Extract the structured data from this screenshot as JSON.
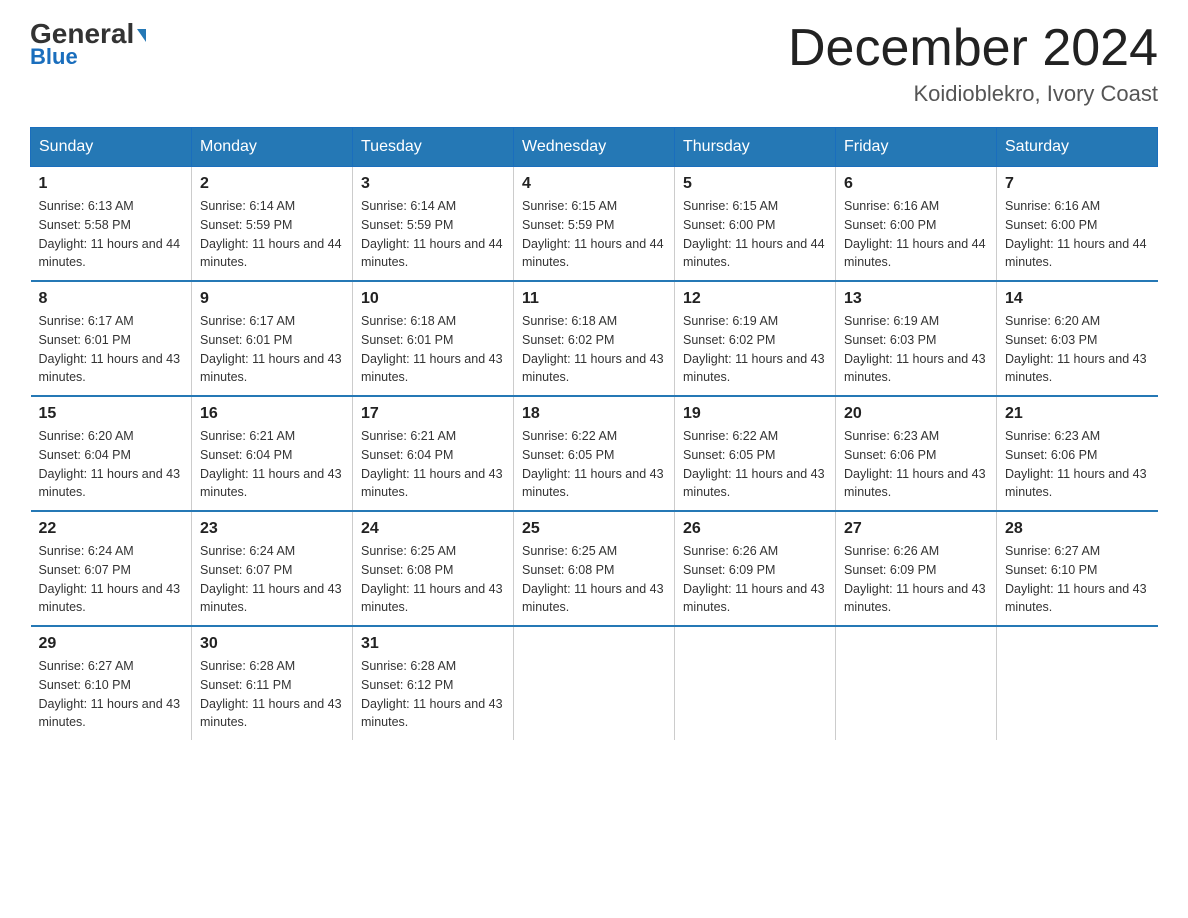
{
  "header": {
    "logo_line1": "General",
    "logo_line2": "Blue",
    "month_title": "December 2024",
    "location": "Koidioblekro, Ivory Coast"
  },
  "days_of_week": [
    "Sunday",
    "Monday",
    "Tuesday",
    "Wednesday",
    "Thursday",
    "Friday",
    "Saturday"
  ],
  "weeks": [
    [
      {
        "day": "1",
        "sunrise": "6:13 AM",
        "sunset": "5:58 PM",
        "daylight": "11 hours and 44 minutes."
      },
      {
        "day": "2",
        "sunrise": "6:14 AM",
        "sunset": "5:59 PM",
        "daylight": "11 hours and 44 minutes."
      },
      {
        "day": "3",
        "sunrise": "6:14 AM",
        "sunset": "5:59 PM",
        "daylight": "11 hours and 44 minutes."
      },
      {
        "day": "4",
        "sunrise": "6:15 AM",
        "sunset": "5:59 PM",
        "daylight": "11 hours and 44 minutes."
      },
      {
        "day": "5",
        "sunrise": "6:15 AM",
        "sunset": "6:00 PM",
        "daylight": "11 hours and 44 minutes."
      },
      {
        "day": "6",
        "sunrise": "6:16 AM",
        "sunset": "6:00 PM",
        "daylight": "11 hours and 44 minutes."
      },
      {
        "day": "7",
        "sunrise": "6:16 AM",
        "sunset": "6:00 PM",
        "daylight": "11 hours and 44 minutes."
      }
    ],
    [
      {
        "day": "8",
        "sunrise": "6:17 AM",
        "sunset": "6:01 PM",
        "daylight": "11 hours and 43 minutes."
      },
      {
        "day": "9",
        "sunrise": "6:17 AM",
        "sunset": "6:01 PM",
        "daylight": "11 hours and 43 minutes."
      },
      {
        "day": "10",
        "sunrise": "6:18 AM",
        "sunset": "6:01 PM",
        "daylight": "11 hours and 43 minutes."
      },
      {
        "day": "11",
        "sunrise": "6:18 AM",
        "sunset": "6:02 PM",
        "daylight": "11 hours and 43 minutes."
      },
      {
        "day": "12",
        "sunrise": "6:19 AM",
        "sunset": "6:02 PM",
        "daylight": "11 hours and 43 minutes."
      },
      {
        "day": "13",
        "sunrise": "6:19 AM",
        "sunset": "6:03 PM",
        "daylight": "11 hours and 43 minutes."
      },
      {
        "day": "14",
        "sunrise": "6:20 AM",
        "sunset": "6:03 PM",
        "daylight": "11 hours and 43 minutes."
      }
    ],
    [
      {
        "day": "15",
        "sunrise": "6:20 AM",
        "sunset": "6:04 PM",
        "daylight": "11 hours and 43 minutes."
      },
      {
        "day": "16",
        "sunrise": "6:21 AM",
        "sunset": "6:04 PM",
        "daylight": "11 hours and 43 minutes."
      },
      {
        "day": "17",
        "sunrise": "6:21 AM",
        "sunset": "6:04 PM",
        "daylight": "11 hours and 43 minutes."
      },
      {
        "day": "18",
        "sunrise": "6:22 AM",
        "sunset": "6:05 PM",
        "daylight": "11 hours and 43 minutes."
      },
      {
        "day": "19",
        "sunrise": "6:22 AM",
        "sunset": "6:05 PM",
        "daylight": "11 hours and 43 minutes."
      },
      {
        "day": "20",
        "sunrise": "6:23 AM",
        "sunset": "6:06 PM",
        "daylight": "11 hours and 43 minutes."
      },
      {
        "day": "21",
        "sunrise": "6:23 AM",
        "sunset": "6:06 PM",
        "daylight": "11 hours and 43 minutes."
      }
    ],
    [
      {
        "day": "22",
        "sunrise": "6:24 AM",
        "sunset": "6:07 PM",
        "daylight": "11 hours and 43 minutes."
      },
      {
        "day": "23",
        "sunrise": "6:24 AM",
        "sunset": "6:07 PM",
        "daylight": "11 hours and 43 minutes."
      },
      {
        "day": "24",
        "sunrise": "6:25 AM",
        "sunset": "6:08 PM",
        "daylight": "11 hours and 43 minutes."
      },
      {
        "day": "25",
        "sunrise": "6:25 AM",
        "sunset": "6:08 PM",
        "daylight": "11 hours and 43 minutes."
      },
      {
        "day": "26",
        "sunrise": "6:26 AM",
        "sunset": "6:09 PM",
        "daylight": "11 hours and 43 minutes."
      },
      {
        "day": "27",
        "sunrise": "6:26 AM",
        "sunset": "6:09 PM",
        "daylight": "11 hours and 43 minutes."
      },
      {
        "day": "28",
        "sunrise": "6:27 AM",
        "sunset": "6:10 PM",
        "daylight": "11 hours and 43 minutes."
      }
    ],
    [
      {
        "day": "29",
        "sunrise": "6:27 AM",
        "sunset": "6:10 PM",
        "daylight": "11 hours and 43 minutes."
      },
      {
        "day": "30",
        "sunrise": "6:28 AM",
        "sunset": "6:11 PM",
        "daylight": "11 hours and 43 minutes."
      },
      {
        "day": "31",
        "sunrise": "6:28 AM",
        "sunset": "6:12 PM",
        "daylight": "11 hours and 43 minutes."
      },
      {
        "day": "",
        "sunrise": "",
        "sunset": "",
        "daylight": ""
      },
      {
        "day": "",
        "sunrise": "",
        "sunset": "",
        "daylight": ""
      },
      {
        "day": "",
        "sunrise": "",
        "sunset": "",
        "daylight": ""
      },
      {
        "day": "",
        "sunrise": "",
        "sunset": "",
        "daylight": ""
      }
    ]
  ],
  "labels": {
    "sunrise_prefix": "Sunrise: ",
    "sunset_prefix": "Sunset: ",
    "daylight_prefix": "Daylight: "
  }
}
